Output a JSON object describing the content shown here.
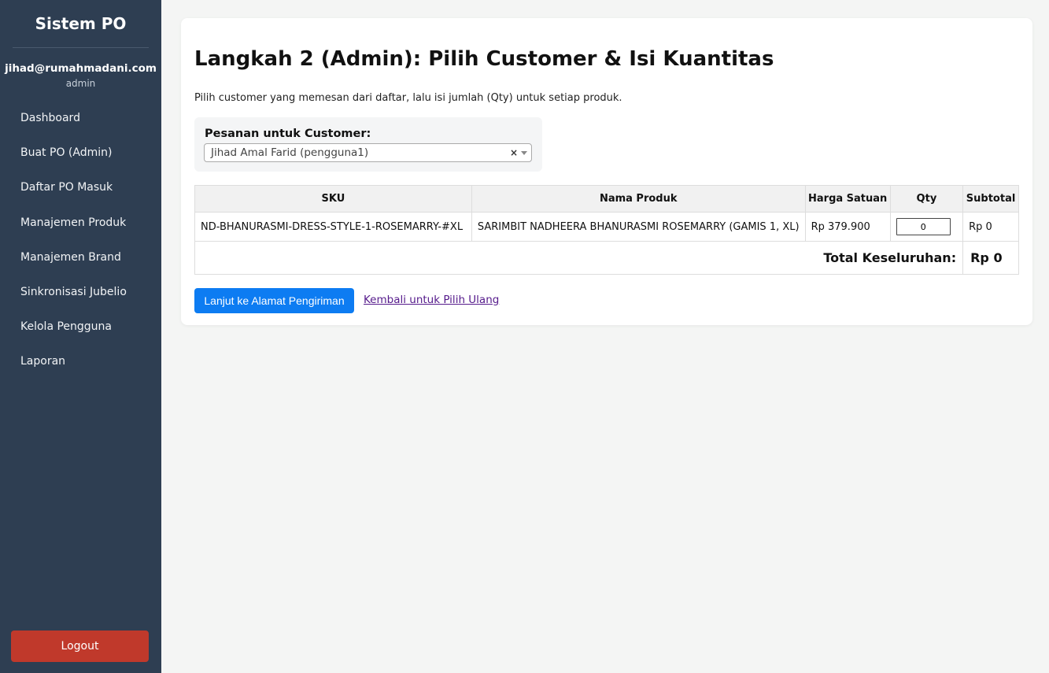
{
  "sidebar": {
    "brand": "Sistem PO",
    "user_email": "jihad@rumahmadani.com",
    "user_role": "admin",
    "items": [
      {
        "label": "Dashboard"
      },
      {
        "label": "Buat PO (Admin)"
      },
      {
        "label": "Daftar PO Masuk"
      },
      {
        "label": "Manajemen Produk"
      },
      {
        "label": "Manajemen Brand"
      },
      {
        "label": "Sinkronisasi Jubelio"
      },
      {
        "label": "Kelola Pengguna"
      },
      {
        "label": "Laporan"
      }
    ],
    "logout_label": "Logout"
  },
  "main": {
    "title": "Langkah 2 (Admin): Pilih Customer & Isi Kuantitas",
    "description": "Pilih customer yang memesan dari daftar, lalu isi jumlah (Qty) untuk setiap produk.",
    "customer": {
      "label": "Pesanan untuk Customer:",
      "selected": "Jihad Amal Farid (pengguna1)",
      "clear_symbol": "×"
    },
    "table": {
      "headers": {
        "sku": "SKU",
        "name": "Nama Produk",
        "price": "Harga Satuan",
        "qty": "Qty",
        "subtotal": "Subtotal"
      },
      "rows": [
        {
          "sku": "ND-BHANURASMI-DRESS-STYLE-1-ROSEMARRY-#XL",
          "name": "SARIMBIT NADHEERA BHANURASMI ROSEMARRY (GAMIS 1, XL)",
          "price": "Rp 379.900",
          "qty": "0",
          "subtotal": "Rp 0"
        }
      ],
      "total_label": "Total Keseluruhan:",
      "total_value": "Rp 0"
    },
    "actions": {
      "continue_label": "Lanjut ke Alamat Pengiriman",
      "back_label": "Kembali untuk Pilih Ulang"
    }
  },
  "colors": {
    "sidebar_bg": "#2e3e52",
    "logout_bg": "#c0392b",
    "primary": "#0d7cf2",
    "link_visited": "#551a8b"
  }
}
